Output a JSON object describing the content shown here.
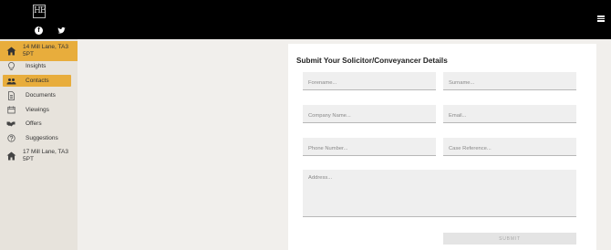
{
  "header": {
    "logo_text": "HE",
    "social": [
      "facebook-icon",
      "twitter-icon"
    ],
    "menu_icon": "hamburger-menu-icon",
    "background": "#000000"
  },
  "sidebar": {
    "accent": "#e8ad3c",
    "items": [
      {
        "label": "14 Mill Lane, TA3 5PT",
        "icon": "house-icon",
        "active": true
      },
      {
        "label": "Insights",
        "icon": "lightbulb-icon"
      },
      {
        "label": "Contacts",
        "icon": "people-icon",
        "active": true
      },
      {
        "label": "Documents",
        "icon": "document-icon"
      },
      {
        "label": "Viewings",
        "icon": "calendar-icon"
      },
      {
        "label": "Offers",
        "icon": "offer-icon"
      },
      {
        "label": "Suggestions",
        "icon": "question-icon"
      },
      {
        "label": "17 Mill Lane, TA3 5PT",
        "icon": "house-icon"
      }
    ]
  },
  "form": {
    "title": "Submit Your Solicitor/Conveyancer Details",
    "forename_placeholder": "Forename...",
    "surname_placeholder": "Surname...",
    "company_placeholder": "Company Name...",
    "email_placeholder": "Email...",
    "phone_placeholder": "Phone Number...",
    "case_placeholder": "Case Reference...",
    "address_placeholder": "Address...",
    "submit_label": "SUBMIT"
  }
}
